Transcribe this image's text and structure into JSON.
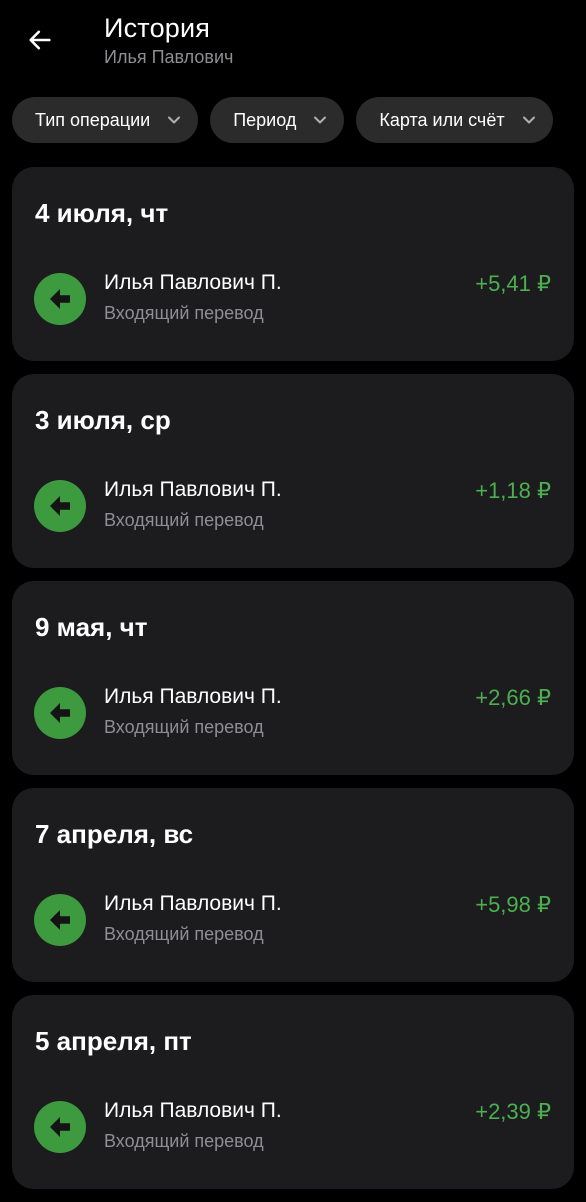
{
  "header": {
    "back_icon": "arrow-left-icon",
    "title": "История",
    "subtitle": "Илья Павлович"
  },
  "filters": [
    {
      "label": "Тип операции",
      "icon": "chevron-down-icon"
    },
    {
      "label": "Период",
      "icon": "chevron-down-icon"
    },
    {
      "label": "Карта или счёт",
      "icon": "chevron-down-icon"
    }
  ],
  "colors": {
    "background": "#000000",
    "card": "#1c1c1e",
    "chip": "#2b2b2b",
    "icon_circle": "#3d9a3f",
    "amount_positive": "#4caf50",
    "secondary_text": "#8e8e93"
  },
  "groups": [
    {
      "date": "4 июля, чт",
      "transaction": {
        "icon": "incoming-arrow-icon",
        "name": "Илья Павлович П.",
        "type": "Входящий перевод",
        "amount": "+5,41 ₽"
      }
    },
    {
      "date": "3 июля, ср",
      "transaction": {
        "icon": "incoming-arrow-icon",
        "name": "Илья Павлович П.",
        "type": "Входящий перевод",
        "amount": "+1,18 ₽"
      }
    },
    {
      "date": "9 мая, чт",
      "transaction": {
        "icon": "incoming-arrow-icon",
        "name": "Илья Павлович П.",
        "type": "Входящий перевод",
        "amount": "+2,66 ₽"
      }
    },
    {
      "date": "7 апреля, вс",
      "transaction": {
        "icon": "incoming-arrow-icon",
        "name": "Илья Павлович П.",
        "type": "Входящий перевод",
        "amount": "+5,98 ₽"
      }
    },
    {
      "date": "5 апреля, пт",
      "transaction": {
        "icon": "incoming-arrow-icon",
        "name": "Илья Павлович П.",
        "type": "Входящий перевод",
        "amount": "+2,39 ₽"
      }
    }
  ]
}
